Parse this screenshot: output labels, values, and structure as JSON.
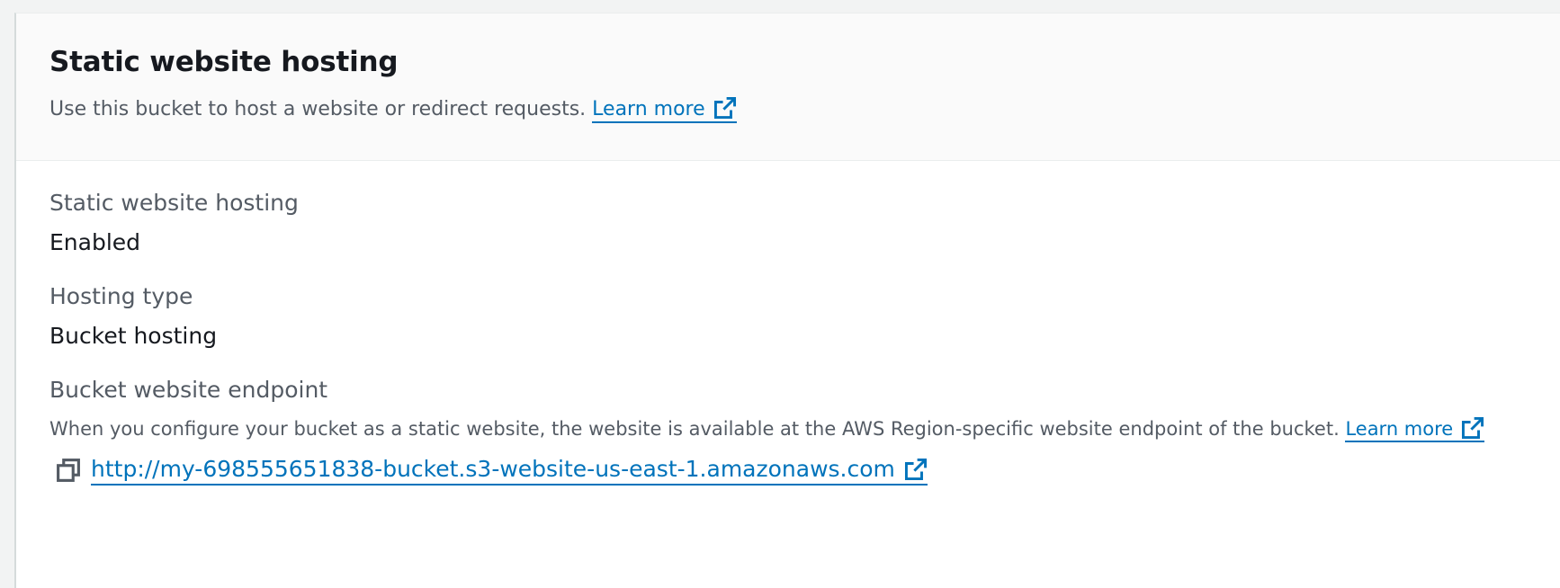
{
  "header": {
    "title": "Static website hosting",
    "description": "Use this bucket to host a website or redirect requests.",
    "learn_more": "Learn more"
  },
  "fields": {
    "hosting": {
      "label": "Static website hosting",
      "value": "Enabled"
    },
    "type": {
      "label": "Hosting type",
      "value": "Bucket hosting"
    },
    "endpoint": {
      "label": "Bucket website endpoint",
      "description": "When you configure your bucket as a static website, the website is available at the AWS Region-specific website endpoint of the bucket.",
      "learn_more": "Learn more",
      "url": "http://my-698555651838-bucket.s3-website-us-east-1.amazonaws.com"
    }
  },
  "icons": {
    "external": "external-link-icon",
    "copy": "copy-icon"
  },
  "colors": {
    "link": "#0073bb",
    "text": "#16191f",
    "muted": "#545b64",
    "header_bg": "#fafafa"
  }
}
